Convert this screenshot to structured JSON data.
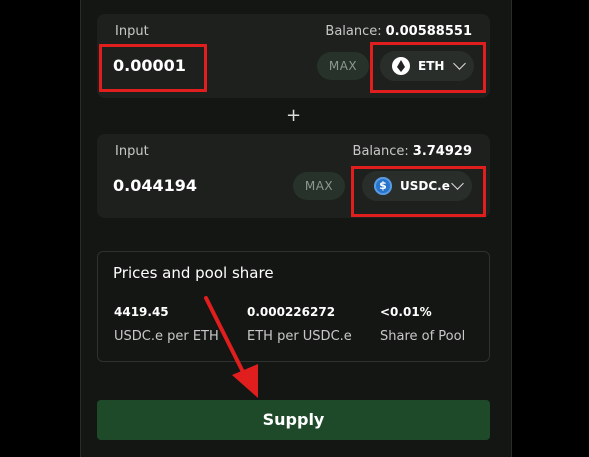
{
  "input1": {
    "label": "Input",
    "balance_label": "Balance:",
    "balance": "0.00588551",
    "amount": "0.00001",
    "max_label": "MAX",
    "token": "ETH"
  },
  "plus": "+",
  "input2": {
    "label": "Input",
    "balance_label": "Balance:",
    "balance": "3.74929",
    "amount": "0.044194",
    "max_label": "MAX",
    "token": "USDC.e"
  },
  "pool": {
    "title": "Prices and pool share",
    "stats": [
      {
        "value": "4419.45",
        "desc": "USDC.e per ETH"
      },
      {
        "value": "0.000226272",
        "desc": "ETH per USDC.e"
      },
      {
        "value": "<0.01%",
        "desc": "Share of Pool"
      }
    ]
  },
  "supply_label": "Supply",
  "colors": {
    "highlight": "#e01e1e",
    "supply_bg": "#1f4a2a",
    "usdc": "#2775ca"
  },
  "icons": {
    "token1": "eth-icon",
    "token2": "usdc-icon",
    "dropdown": "chevron-down-icon"
  }
}
